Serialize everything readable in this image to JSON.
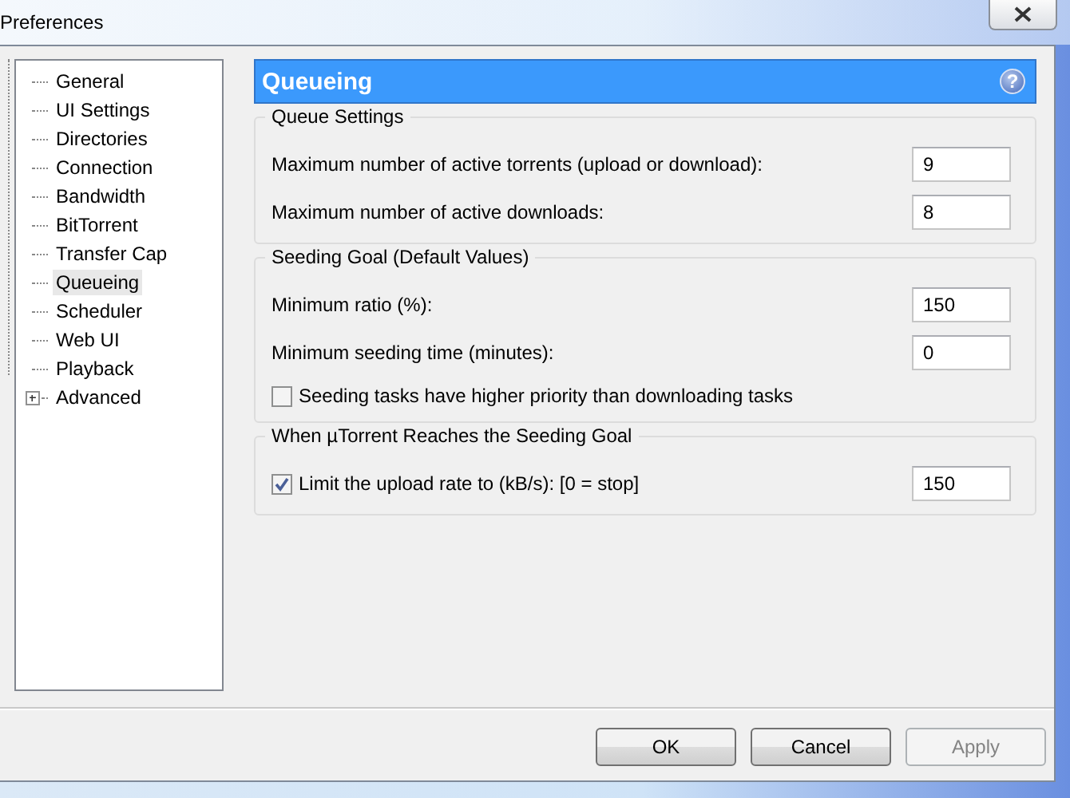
{
  "window": {
    "title": "Preferences"
  },
  "sidebar": {
    "items": [
      {
        "label": "General",
        "kind": "page",
        "selected": false
      },
      {
        "label": "UI Settings",
        "kind": "page",
        "selected": false
      },
      {
        "label": "Directories",
        "kind": "page",
        "selected": false
      },
      {
        "label": "Connection",
        "kind": "page",
        "selected": false
      },
      {
        "label": "Bandwidth",
        "kind": "page",
        "selected": false
      },
      {
        "label": "BitTorrent",
        "kind": "page",
        "selected": false
      },
      {
        "label": "Transfer Cap",
        "kind": "page",
        "selected": false
      },
      {
        "label": "Queueing",
        "kind": "page",
        "selected": true
      },
      {
        "label": "Scheduler",
        "kind": "page",
        "selected": false
      },
      {
        "label": "Web UI",
        "kind": "page",
        "selected": false
      },
      {
        "label": "Playback",
        "kind": "page",
        "selected": false
      },
      {
        "label": "Advanced",
        "kind": "branch",
        "selected": false,
        "expanded": false
      }
    ]
  },
  "panel": {
    "title": "Queueing",
    "help": "?"
  },
  "groups": [
    {
      "title": "Queue Settings",
      "rows": [
        {
          "kind": "number",
          "label": "Maximum number of active torrents (upload or download):",
          "value": "9"
        },
        {
          "kind": "number",
          "label": "Maximum number of active downloads:",
          "value": "8"
        }
      ]
    },
    {
      "title": "Seeding Goal (Default Values)",
      "rows": [
        {
          "kind": "number",
          "label": "Minimum ratio (%):",
          "value": "150"
        },
        {
          "kind": "number",
          "label": "Minimum seeding time (minutes):",
          "value": "0"
        },
        {
          "kind": "checkbox",
          "label": "Seeding tasks have higher priority than downloading tasks",
          "checked": false
        }
      ]
    },
    {
      "title": "When µTorrent Reaches the Seeding Goal",
      "rows": [
        {
          "kind": "checkbox_number",
          "label": "Limit the upload rate to (kB/s): [0 = stop]",
          "checked": true,
          "value": "150"
        }
      ]
    }
  ],
  "buttons": [
    {
      "label": "OK",
      "disabled": false
    },
    {
      "label": "Cancel",
      "disabled": false
    },
    {
      "label": "Apply",
      "disabled": true
    }
  ]
}
